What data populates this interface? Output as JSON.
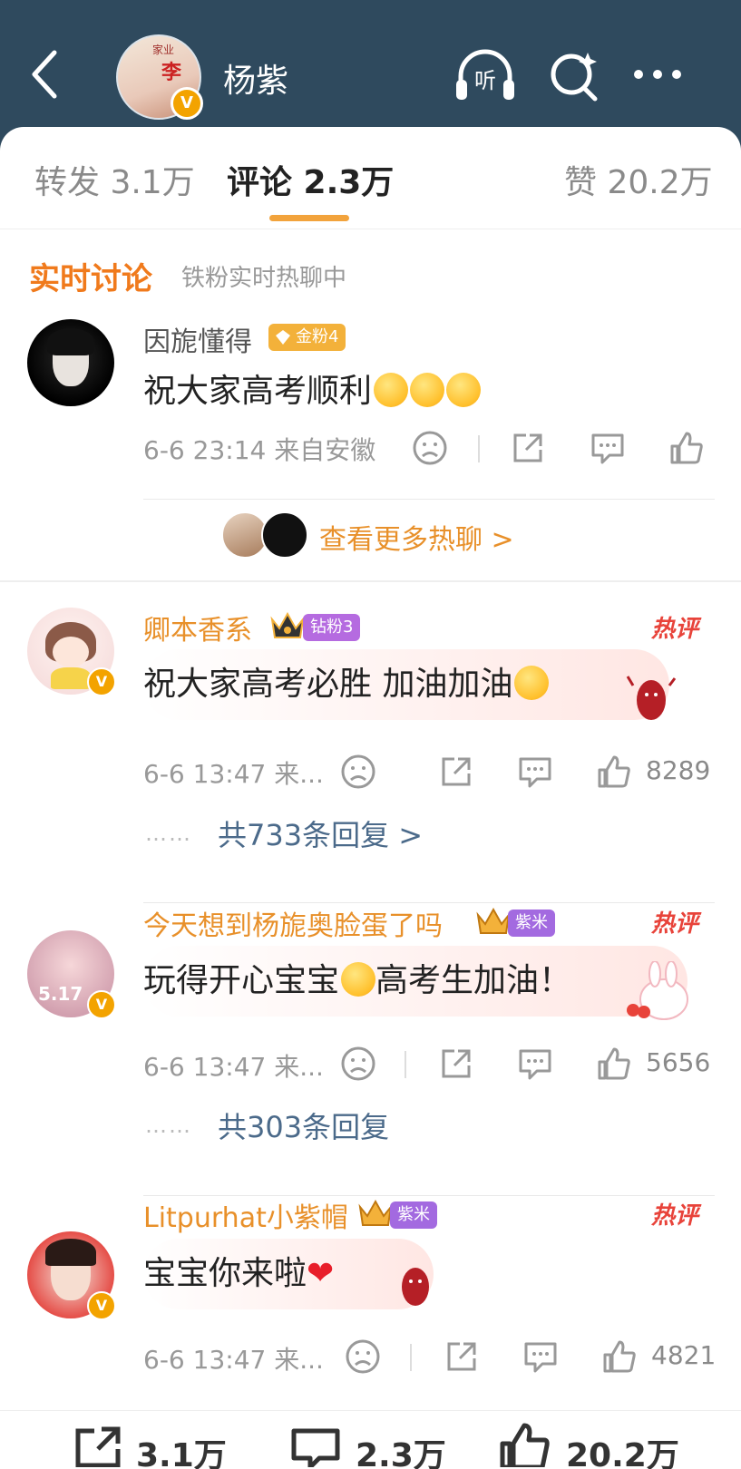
{
  "header": {
    "title": "杨紫",
    "avatar_text_small": "家业",
    "avatar_text_big": "李",
    "badge": "V",
    "icons": [
      "back-icon",
      "listen-icon",
      "search-icon",
      "more-icon"
    ],
    "listen_label": "听"
  },
  "tabs": [
    {
      "label": "转发 3.1万",
      "active": false
    },
    {
      "label": "评论 2.3万",
      "active": true
    },
    {
      "label": "赞 20.2万",
      "active": false
    }
  ],
  "live": {
    "title": "实时讨论",
    "subtitle": "铁粉实时热聊中",
    "comment": {
      "user": "因旎懂得",
      "badge": "金粉4",
      "text": "祝大家高考顺利",
      "time": "6-6 23:14 来自安徽"
    },
    "more_label": "查看更多热聊 >"
  },
  "comments": [
    {
      "user": "卿本香系",
      "badge": "钻粉3",
      "hot_label": "热评",
      "text": "祝大家高考必胜 加油加油",
      "time": "6-6 13:47 来...",
      "likes": "8289",
      "replies": "共733条回复 >"
    },
    {
      "user": "今天想到杨旎奥脸蛋了吗",
      "badge": "紫米",
      "hot_label": "热评",
      "text_before": "玩得开心宝宝",
      "text_after": "高考生加油！",
      "time": "6-6 13:47 来...",
      "likes": "5656",
      "replies": "共303条回复",
      "avatar_label": "5.17"
    },
    {
      "user": "Litpurhat小紫帽",
      "badge": "紫米",
      "hot_label": "热评",
      "text": "宝宝你来啦",
      "heart": "❤",
      "time": "6-6 13:47 来...",
      "likes": "4821"
    }
  ],
  "bottom": {
    "repost": "3.1万",
    "comment": "2.3万",
    "like": "20.2万"
  },
  "colors": {
    "header_bg": "#2f4a5e",
    "accent_orange": "#f07a1c",
    "hot_red": "#e8433a",
    "reply_blue": "#4b6a8a",
    "gold_badge": "#f3b13a",
    "diamond_badge": "#b56be0",
    "purple_badge": "#a36ae0"
  }
}
